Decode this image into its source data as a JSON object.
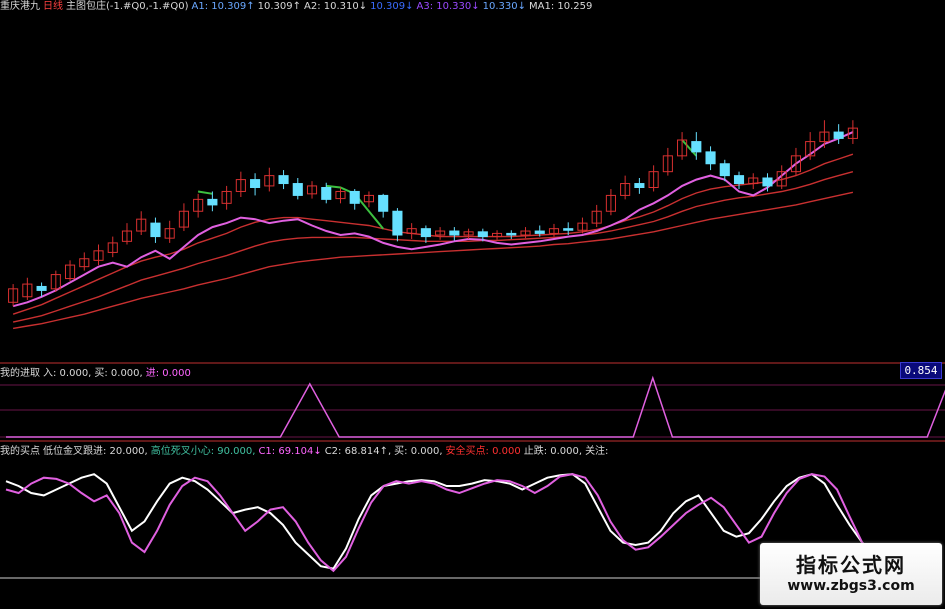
{
  "colors": {
    "bg": "#000000",
    "up": "#d83030",
    "down": "#66e0ff",
    "ma_red": "#c83030",
    "ma_pink": "#e060e0",
    "green": "#3cc040",
    "white": "#ffffff",
    "blue": "#2a6cff",
    "yellow": "#e0e060",
    "label": "#d8d8d8"
  },
  "header_main": [
    {
      "text": "重庆港九",
      "color": "#d8d8d8"
    },
    {
      "text": "日线",
      "color": "#ff4040"
    },
    {
      "text": "主图包庄(-1.#Q0,-1.#Q0)",
      "color": "#d8d8d8"
    },
    {
      "text": "A1: 10.309↑",
      "color": "#6aa8ff"
    },
    {
      "text": "10.309↑",
      "color": "#d8d8d8"
    },
    {
      "text": "A2: 10.310↓",
      "color": "#d8d8d8"
    },
    {
      "text": "10.309↓",
      "color": "#3a6cff"
    },
    {
      "text": "A3: 10.330↓",
      "color": "#9a4aff"
    },
    {
      "text": "10.330↓",
      "color": "#6aa8ff"
    },
    {
      "text": "MA1: 10.259",
      "color": "#d8d8d8"
    }
  ],
  "header_mid": [
    {
      "text": "我的进取",
      "color": "#d8d8d8"
    },
    {
      "text": "入: 0.000,",
      "color": "#d8d8d8"
    },
    {
      "text": "买: 0.000,",
      "color": "#d8d8d8"
    },
    {
      "text": "进: 0.000",
      "color": "#ff66ff"
    }
  ],
  "header_bot": [
    {
      "text": "我的买点",
      "color": "#d8d8d8"
    },
    {
      "text": "低位金叉跟进: 20.000,",
      "color": "#d8d8d8"
    },
    {
      "text": "高位死叉小心: 90.000,",
      "color": "#40c0a0"
    },
    {
      "text": "C1: 69.104↓",
      "color": "#ff66ff"
    },
    {
      "text": "C2: 68.814↑,",
      "color": "#d8d8d8"
    },
    {
      "text": "买: 0.000,",
      "color": "#d8d8d8"
    },
    {
      "text": "安全买点: 0.000",
      "color": "#ff3030"
    },
    {
      "text": "止跌: 0.000,",
      "color": "#d8d8d8"
    },
    {
      "text": "关注:",
      "color": "#d8d8d8"
    }
  ],
  "mid_value": "0.854",
  "watermark": {
    "title": "指标公式网",
    "site": "www.zbgs3.com"
  },
  "chart_data": [
    {
      "type": "candlestick",
      "panel": "main",
      "ylim": [
        9.2,
        11.6
      ],
      "candles": [
        [
          9.55,
          9.72,
          9.5,
          9.78
        ],
        [
          9.62,
          9.78,
          9.58,
          9.86
        ],
        [
          9.75,
          9.7,
          9.62,
          9.8
        ],
        [
          9.72,
          9.9,
          9.68,
          9.95
        ],
        [
          9.85,
          10.02,
          9.82,
          10.08
        ],
        [
          10.0,
          10.1,
          9.95,
          10.18
        ],
        [
          10.08,
          10.2,
          10.02,
          10.28
        ],
        [
          10.18,
          10.3,
          10.12,
          10.38
        ],
        [
          10.32,
          10.45,
          10.28,
          10.55
        ],
        [
          10.45,
          10.6,
          10.4,
          10.7
        ],
        [
          10.55,
          10.38,
          10.3,
          10.62
        ],
        [
          10.36,
          10.48,
          10.3,
          10.58
        ],
        [
          10.5,
          10.7,
          10.45,
          10.8
        ],
        [
          10.7,
          10.85,
          10.62,
          10.92
        ],
        [
          10.85,
          10.78,
          10.7,
          10.95
        ],
        [
          10.8,
          10.95,
          10.72,
          11.02
        ],
        [
          10.95,
          11.1,
          10.88,
          11.2
        ],
        [
          11.1,
          11.0,
          10.9,
          11.18
        ],
        [
          11.02,
          11.15,
          10.95,
          11.25
        ],
        [
          11.15,
          11.05,
          10.98,
          11.22
        ],
        [
          11.05,
          10.9,
          10.85,
          11.12
        ],
        [
          10.92,
          11.02,
          10.86,
          11.08
        ],
        [
          11.0,
          10.85,
          10.8,
          11.06
        ],
        [
          10.86,
          10.95,
          10.8,
          11.0
        ],
        [
          10.95,
          10.8,
          10.72,
          10.98
        ],
        [
          10.82,
          10.9,
          10.75,
          10.95
        ],
        [
          10.9,
          10.7,
          10.62,
          10.92
        ],
        [
          10.7,
          10.4,
          10.32,
          10.74
        ],
        [
          10.42,
          10.48,
          10.35,
          10.55
        ],
        [
          10.48,
          10.38,
          10.3,
          10.52
        ],
        [
          10.4,
          10.45,
          10.34,
          10.5
        ],
        [
          10.45,
          10.4,
          10.33,
          10.5
        ],
        [
          10.4,
          10.44,
          10.35,
          10.48
        ],
        [
          10.44,
          10.38,
          10.32,
          10.48
        ],
        [
          10.38,
          10.42,
          10.34,
          10.46
        ],
        [
          10.42,
          10.4,
          10.35,
          10.46
        ],
        [
          10.4,
          10.45,
          10.36,
          10.5
        ],
        [
          10.45,
          10.42,
          10.38,
          10.52
        ],
        [
          10.42,
          10.48,
          10.38,
          10.54
        ],
        [
          10.48,
          10.46,
          10.4,
          10.56
        ],
        [
          10.46,
          10.55,
          10.42,
          10.62
        ],
        [
          10.55,
          10.7,
          10.5,
          10.78
        ],
        [
          10.7,
          10.9,
          10.65,
          10.98
        ],
        [
          10.9,
          11.05,
          10.85,
          11.15
        ],
        [
          11.05,
          11.0,
          10.92,
          11.12
        ],
        [
          11.0,
          11.2,
          10.95,
          11.28
        ],
        [
          11.2,
          11.4,
          11.15,
          11.5
        ],
        [
          11.4,
          11.6,
          11.35,
          11.7
        ],
        [
          11.58,
          11.45,
          11.35,
          11.7
        ],
        [
          11.45,
          11.3,
          11.22,
          11.52
        ],
        [
          11.3,
          11.15,
          11.08,
          11.35
        ],
        [
          11.15,
          11.05,
          10.98,
          11.2
        ],
        [
          11.05,
          11.12,
          10.98,
          11.18
        ],
        [
          11.12,
          11.02,
          10.95,
          11.18
        ],
        [
          11.02,
          11.2,
          10.98,
          11.28
        ],
        [
          11.2,
          11.4,
          11.15,
          11.5
        ],
        [
          11.4,
          11.58,
          11.35,
          11.7
        ],
        [
          11.58,
          11.7,
          11.5,
          11.85
        ],
        [
          11.7,
          11.62,
          11.55,
          11.8
        ],
        [
          11.62,
          11.75,
          11.55,
          11.85
        ]
      ],
      "ma_red": [
        [
          9.4,
          9.46,
          9.52,
          9.6,
          9.68,
          9.76,
          9.84,
          9.92,
          10.0,
          10.07,
          10.12,
          10.16,
          10.22,
          10.3,
          10.36,
          10.42,
          10.5,
          10.56,
          10.6,
          10.62,
          10.62,
          10.6,
          10.58,
          10.56,
          10.54,
          10.52,
          10.48,
          10.44,
          10.42,
          10.4,
          10.38,
          10.38,
          10.38,
          10.38,
          10.38,
          10.38,
          10.39,
          10.4,
          10.41,
          10.42,
          10.44,
          10.47,
          10.52,
          10.58,
          10.63,
          10.69,
          10.77,
          10.86,
          10.93,
          10.98,
          11.01,
          11.03,
          11.05,
          11.07,
          11.1,
          11.15,
          11.22,
          11.3,
          11.36,
          11.42
        ],
        [
          9.3,
          9.34,
          9.38,
          9.44,
          9.5,
          9.56,
          9.62,
          9.69,
          9.76,
          9.83,
          9.88,
          9.93,
          9.98,
          10.04,
          10.09,
          10.14,
          10.2,
          10.26,
          10.31,
          10.34,
          10.36,
          10.37,
          10.37,
          10.37,
          10.37,
          10.36,
          10.35,
          10.34,
          10.33,
          10.32,
          10.32,
          10.32,
          10.32,
          10.33,
          10.33,
          10.34,
          10.35,
          10.36,
          10.37,
          10.38,
          10.4,
          10.42,
          10.45,
          10.49,
          10.53,
          10.57,
          10.63,
          10.7,
          10.76,
          10.8,
          10.84,
          10.87,
          10.89,
          10.92,
          10.95,
          10.99,
          11.04,
          11.1,
          11.15,
          11.2
        ],
        [
          9.22,
          9.25,
          9.28,
          9.32,
          9.36,
          9.4,
          9.45,
          9.5,
          9.55,
          9.6,
          9.64,
          9.68,
          9.72,
          9.77,
          9.81,
          9.85,
          9.9,
          9.95,
          10.0,
          10.03,
          10.06,
          10.08,
          10.1,
          10.12,
          10.13,
          10.14,
          10.15,
          10.16,
          10.17,
          10.18,
          10.19,
          10.2,
          10.21,
          10.22,
          10.23,
          10.24,
          10.25,
          10.26,
          10.28,
          10.29,
          10.31,
          10.33,
          10.35,
          10.38,
          10.41,
          10.44,
          10.48,
          10.52,
          10.56,
          10.6,
          10.63,
          10.66,
          10.69,
          10.72,
          10.75,
          10.78,
          10.82,
          10.86,
          10.9,
          10.94
        ]
      ],
      "ma_pink": [
        9.5,
        9.55,
        9.62,
        9.7,
        9.8,
        9.9,
        10.0,
        10.05,
        10.0,
        10.12,
        10.2,
        10.1,
        10.25,
        10.4,
        10.5,
        10.55,
        10.62,
        10.6,
        10.55,
        10.58,
        10.6,
        10.52,
        10.45,
        10.4,
        10.42,
        10.38,
        10.3,
        10.25,
        10.22,
        10.25,
        10.28,
        10.32,
        10.35,
        10.34,
        10.3,
        10.28,
        10.3,
        10.32,
        10.35,
        10.38,
        10.4,
        10.45,
        10.52,
        10.6,
        10.72,
        10.8,
        10.9,
        11.02,
        11.1,
        11.15,
        11.1,
        10.95,
        10.9,
        11.0,
        11.15,
        11.3,
        11.42,
        11.55,
        11.62,
        11.7
      ],
      "ma_green": [
        null,
        null,
        null,
        null,
        null,
        null,
        null,
        null,
        null,
        null,
        null,
        null,
        null,
        10.95,
        10.92,
        null,
        null,
        null,
        null,
        null,
        null,
        null,
        11.02,
        11.0,
        10.92,
        10.7,
        10.48,
        null,
        null,
        null,
        null,
        null,
        null,
        null,
        null,
        null,
        null,
        null,
        null,
        null,
        null,
        null,
        null,
        null,
        null,
        null,
        null,
        11.6,
        11.4,
        null,
        null,
        null,
        null,
        null,
        null,
        null,
        null,
        null,
        null,
        null
      ]
    },
    {
      "type": "line",
      "panel": "mid",
      "ylim": [
        0,
        1
      ],
      "x": [
        0,
        28,
        31,
        34,
        64,
        66,
        68,
        70,
        94,
        96
      ],
      "values": [
        0,
        0,
        0.9,
        0,
        0,
        1,
        0,
        0,
        0,
        0.85
      ]
    },
    {
      "type": "line",
      "panel": "bottom",
      "ylim": [
        0,
        100
      ],
      "series": [
        {
          "color": "#ffffff",
          "values": [
            82,
            78,
            72,
            70,
            75,
            80,
            85,
            88,
            80,
            60,
            40,
            48,
            65,
            80,
            85,
            82,
            75,
            65,
            55,
            58,
            60,
            55,
            45,
            30,
            20,
            10,
            8,
            25,
            50,
            70,
            78,
            80,
            82,
            83,
            82,
            78,
            78,
            80,
            83,
            82,
            80,
            75,
            80,
            85,
            87,
            88,
            80,
            60,
            40,
            30,
            28,
            30,
            40,
            55,
            65,
            70,
            55,
            40,
            35,
            38,
            50,
            65,
            78,
            85,
            88,
            80,
            62,
            45,
            30,
            20,
            15,
            12
          ]
        },
        {
          "color": "#e060e0",
          "values": [
            75,
            72,
            80,
            85,
            84,
            80,
            72,
            65,
            70,
            55,
            30,
            22,
            40,
            62,
            78,
            85,
            82,
            70,
            55,
            40,
            48,
            58,
            60,
            48,
            30,
            15,
            6,
            18,
            42,
            64,
            78,
            82,
            80,
            82,
            80,
            75,
            72,
            76,
            80,
            83,
            82,
            78,
            72,
            78,
            86,
            88,
            85,
            70,
            48,
            32,
            24,
            26,
            35,
            45,
            55,
            62,
            68,
            60,
            45,
            30,
            35,
            55,
            72,
            84,
            88,
            86,
            75,
            52,
            30,
            18,
            12,
            8
          ]
        }
      ]
    }
  ]
}
